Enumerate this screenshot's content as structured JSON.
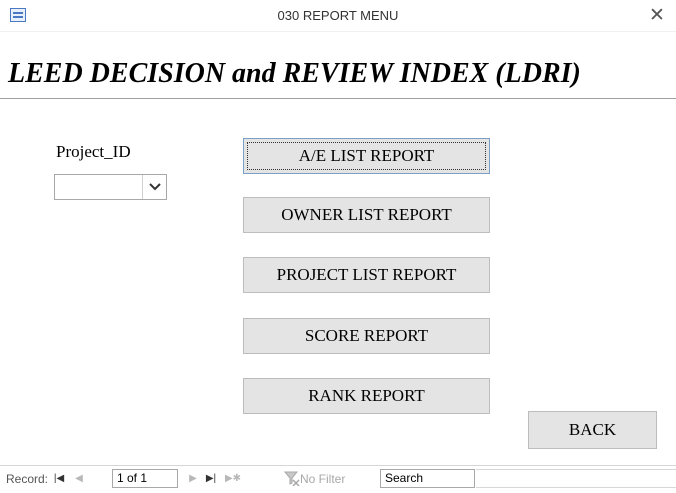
{
  "window": {
    "title": "030 REPORT MENU",
    "close_glyph": "✕",
    "icon": "form-icon"
  },
  "header": {
    "title": "LEED DECISION and REVIEW INDEX (LDRI)"
  },
  "filter": {
    "label": "Project_ID",
    "selected_value": ""
  },
  "buttons": [
    {
      "label": "A/E LIST REPORT",
      "focused": true
    },
    {
      "label": "OWNER LIST REPORT",
      "focused": false
    },
    {
      "label": "PROJECT LIST REPORT",
      "focused": false
    },
    {
      "label": "SCORE REPORT",
      "focused": false
    },
    {
      "label": "RANK REPORT",
      "focused": false
    }
  ],
  "back_button": {
    "label": "BACK"
  },
  "record_nav": {
    "label": "Record:",
    "first": "|◀",
    "prev": "◀",
    "position": "1 of 1",
    "next": "▶",
    "last": "▶|",
    "new": "▶✱",
    "filter_status": "No Filter",
    "search": "Search"
  },
  "colors": {
    "button_face": "#e4e4e4",
    "focus_border": "#7a9fc9",
    "accent_icon": "#4a78c2"
  }
}
